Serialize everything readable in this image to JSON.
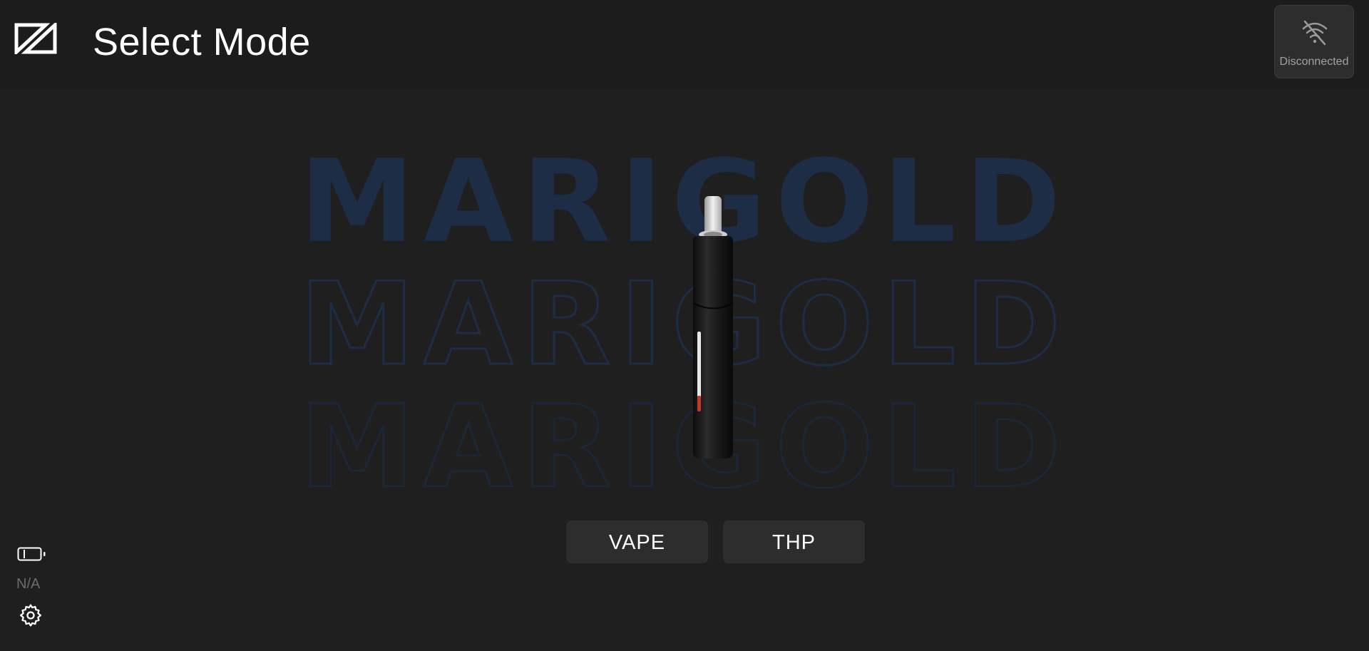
{
  "header": {
    "title": "Select Mode",
    "logo_icon": "brand-logo-icon"
  },
  "connection": {
    "status": "Disconnected",
    "icon": "wifi-off-icon"
  },
  "brand": {
    "name": "MARIGOLD",
    "color": "#1c2d45"
  },
  "modes": {
    "vape_label": "VAPE",
    "thp_label": "THP"
  },
  "battery": {
    "icon": "battery-icon",
    "level": "N/A"
  },
  "settings": {
    "icon": "gear-icon"
  },
  "colors": {
    "background": "#1f1f1f",
    "button": "#2d2d2d",
    "brand": "#1c2d45",
    "heater_red": "#c0392b"
  }
}
